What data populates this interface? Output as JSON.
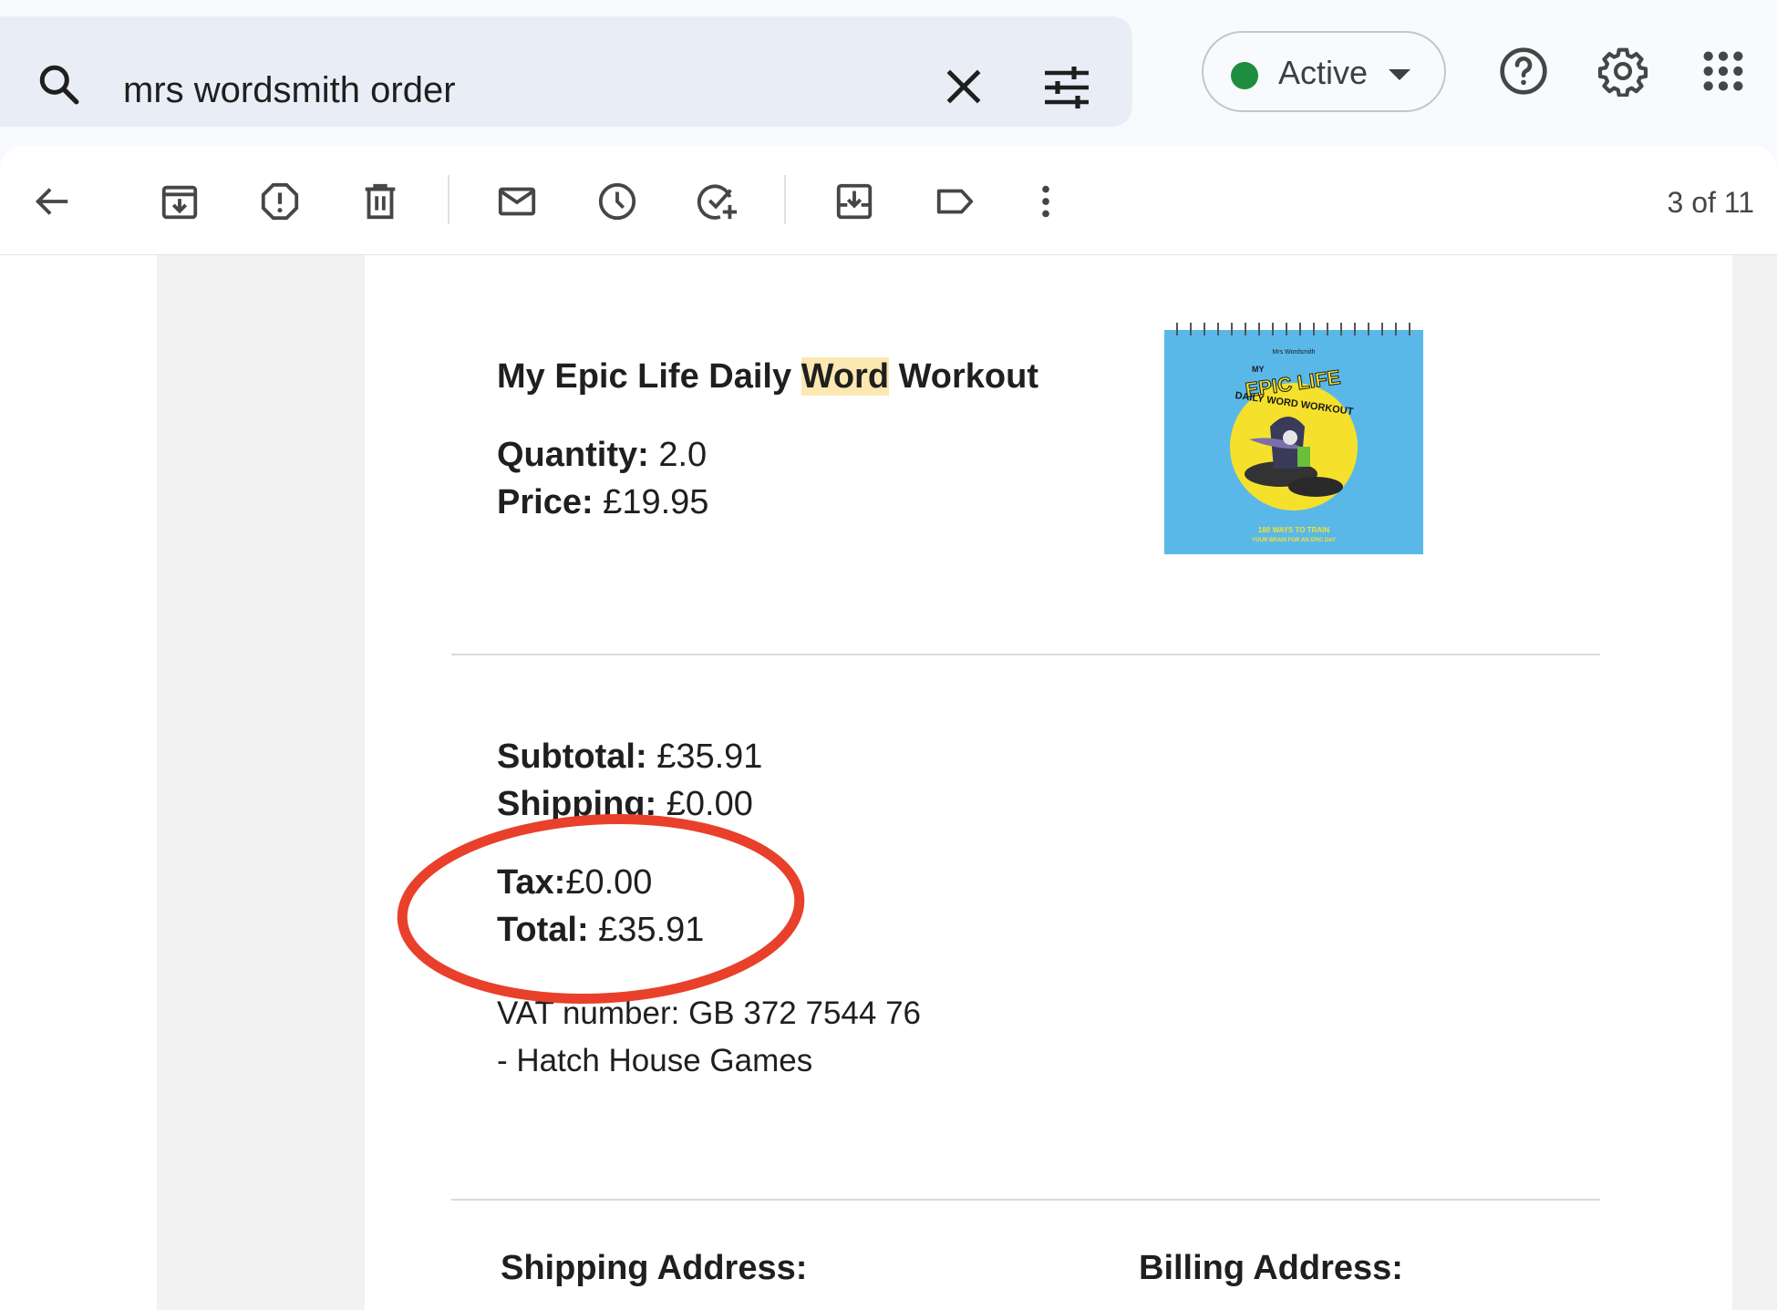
{
  "search": {
    "query": "mrs wordsmith order"
  },
  "status": {
    "label": "Active",
    "color": "#1e8e3e"
  },
  "header_icons": [
    "search-icon",
    "close-icon",
    "filter-icon",
    "help-icon",
    "settings-icon",
    "apps-grid-icon"
  ],
  "toolbar": {
    "icons": [
      "back-arrow-icon",
      "archive-icon",
      "report-spam-icon",
      "delete-icon",
      "mark-unread-icon",
      "snooze-icon",
      "add-task-icon",
      "move-to-icon",
      "label-icon",
      "more-vert-icon"
    ],
    "page_count": "3 of 11"
  },
  "product": {
    "title_before": "My Epic Life Daily ",
    "title_highlight": "Word",
    "title_after": " Workout",
    "quantity_label": "Quantity:",
    "quantity_value": " 2.0",
    "price_label": "Price:",
    "price_value": " £19.95",
    "image": {
      "brand": "Mrs Wordsmith",
      "line1": "MY",
      "line2": "EPIC LIFE",
      "line3": "DAILY WORD WORKOUT",
      "bottom1": "180 WAYS TO TRAIN",
      "bottom2": "YOUR BRAIN FOR AN EPIC DAY",
      "bg_color": "#5ab8e8",
      "accent_color": "#f5e12c"
    }
  },
  "totals": {
    "subtotal_label": "Subtotal:",
    "subtotal_value": " £35.91",
    "shipping_label": "Shipping:",
    "shipping_value": " £0.00",
    "tax_label": "Tax:",
    "tax_value": "£0.00",
    "total_label": "Total:",
    "total_value": " £35.91"
  },
  "vat": {
    "line1": "VAT number: GB 372 7544 76",
    "line2": "- Hatch House Games"
  },
  "addresses": {
    "shipping_heading": "Shipping Address:",
    "billing_heading": "Billing Address:"
  },
  "annotation": {
    "color": "#e8402a"
  }
}
